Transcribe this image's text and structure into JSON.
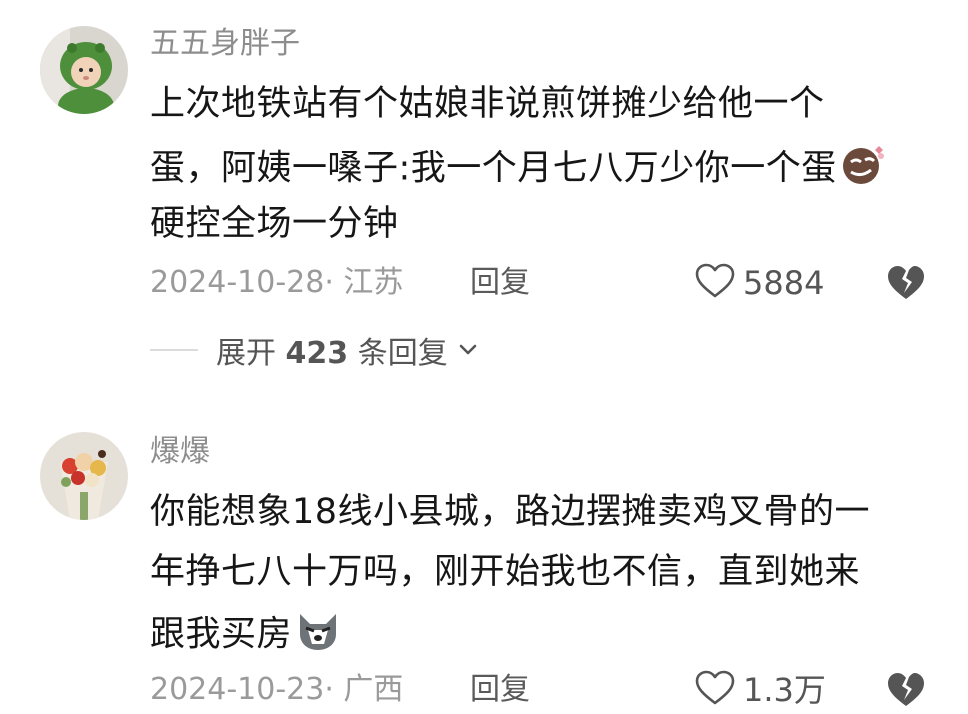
{
  "comments": [
    {
      "username": "五五身胖子",
      "lines": [
        "上次地铁站有个姑娘非说煎饼摊少给他一个",
        "蛋，阿姨一嗓子:我一个月七八万少你一个蛋",
        "硬控全场一分钟"
      ],
      "date_location": "2024-10-28· 江苏",
      "reply_label": "回复",
      "likes": "5884",
      "expand_prefix": "展开 ",
      "expand_count": "423",
      "expand_suffix": " 条回复",
      "emoji": "smirk-emoji",
      "avatar": "baby-in-green-hood"
    },
    {
      "username": "爆爆",
      "lines": [
        "你能想象18线小县城，路边摆摊卖鸡叉骨的一",
        "年挣七八十万吗，刚开始我也不信，直到她来",
        "跟我买房"
      ],
      "date_location": "2024-10-23· 广西",
      "reply_label": "回复",
      "likes": "1.3万",
      "emoji": "husky-emoji",
      "avatar": "flower-bouquet"
    }
  ],
  "colors": {
    "text": "#161616",
    "meta": "#9a9a9a",
    "username": "#8d8d8d",
    "background": "#ffffff"
  }
}
